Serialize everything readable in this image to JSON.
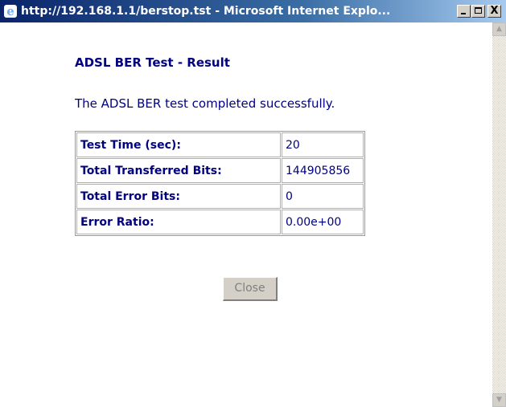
{
  "window": {
    "title": "http://192.168.1.1/berstop.tst - Microsoft Internet Explo...",
    "controls": {
      "minimize": "minimize",
      "maximize": "maximize",
      "close": "X"
    }
  },
  "page": {
    "title": "ADSL BER Test - Result",
    "message": "The ADSL BER test completed successfully."
  },
  "results": [
    {
      "label": "Test Time (sec):",
      "value": "20"
    },
    {
      "label": "Total Transferred Bits:",
      "value": "144905856"
    },
    {
      "label": "Total Error Bits:",
      "value": "0"
    },
    {
      "label": "Error Ratio:",
      "value": "0.00e+00"
    }
  ],
  "buttons": {
    "close": "Close"
  },
  "colors": {
    "text": "#000080",
    "titlebar_start": "#0a246a",
    "titlebar_end": "#a6caf0",
    "button_face": "#d4d0c8"
  }
}
